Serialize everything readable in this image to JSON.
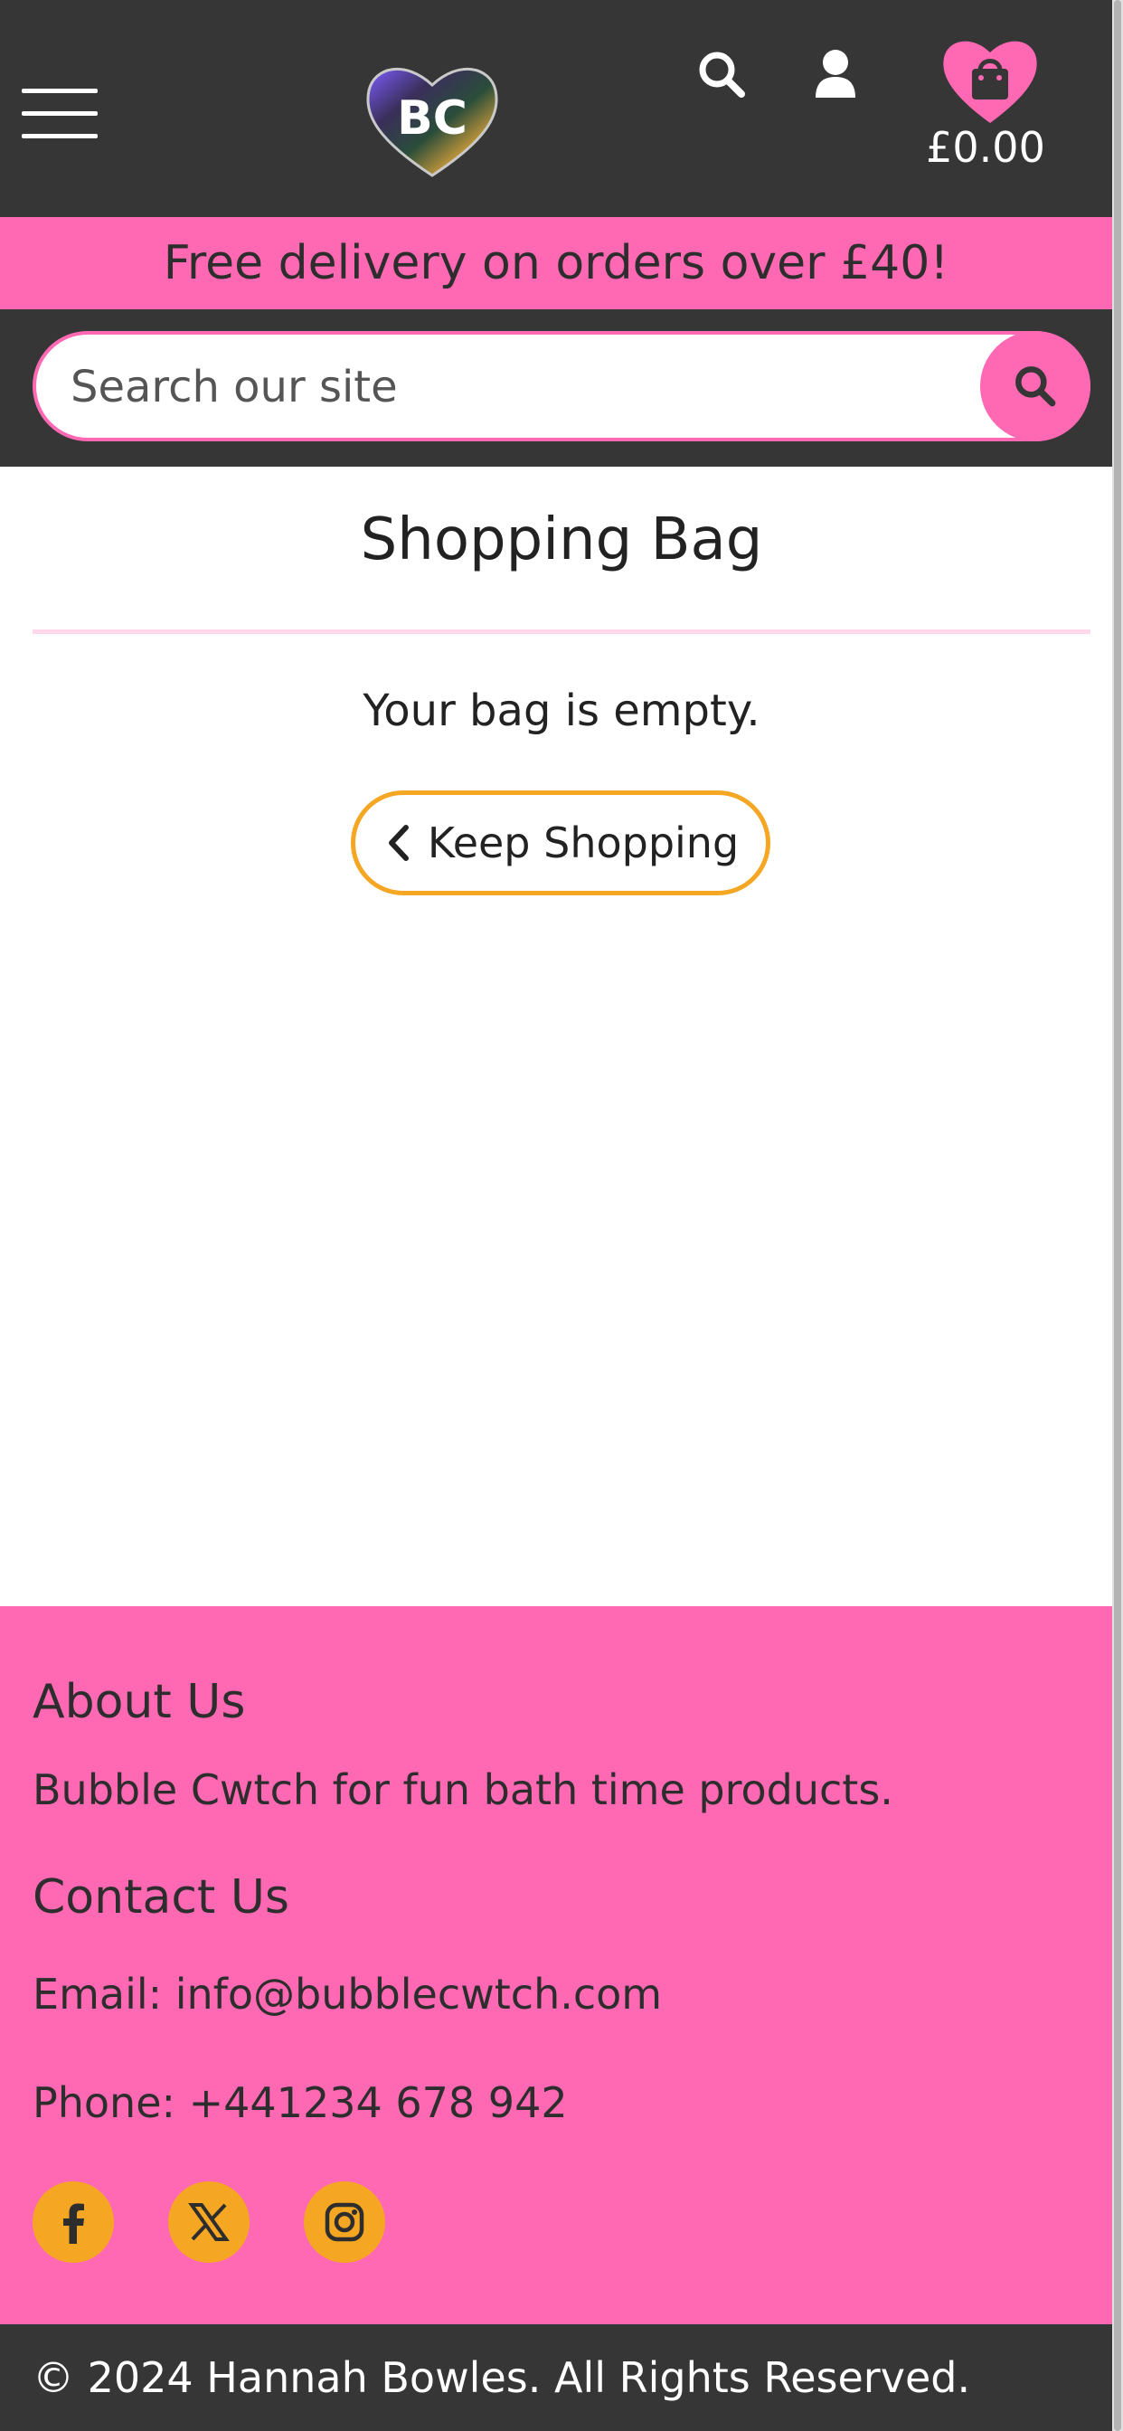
{
  "header": {
    "logo_text": "BC",
    "cart_total": "£0.00",
    "icons": {
      "menu": "hamburger-menu-icon",
      "search": "search-icon",
      "account": "user-icon",
      "cart": "heart-shopping-bag-icon"
    }
  },
  "promo": {
    "text": "Free delivery on orders over £40!"
  },
  "search": {
    "placeholder": "Search our site",
    "value": ""
  },
  "main": {
    "title": "Shopping Bag",
    "empty_message": "Your bag is empty.",
    "keep_shopping_label": "Keep Shopping"
  },
  "footer": {
    "about_heading": "About Us",
    "about_text": "Bubble Cwtch for fun bath time products.",
    "contact_heading": "Contact Us",
    "email_prefix": "Email: ",
    "email": "info@bubblecwtch.com",
    "phone_prefix": "Phone: ",
    "phone": "+441234 678 942",
    "social": [
      "facebook-icon",
      "x-twitter-icon",
      "instagram-icon"
    ],
    "copyright": "© 2024 Hannah Bowles. All Rights Reserved."
  },
  "colors": {
    "dark": "#363636",
    "pink": "#ff69b4",
    "orange": "#f5a623",
    "white": "#ffffff"
  }
}
